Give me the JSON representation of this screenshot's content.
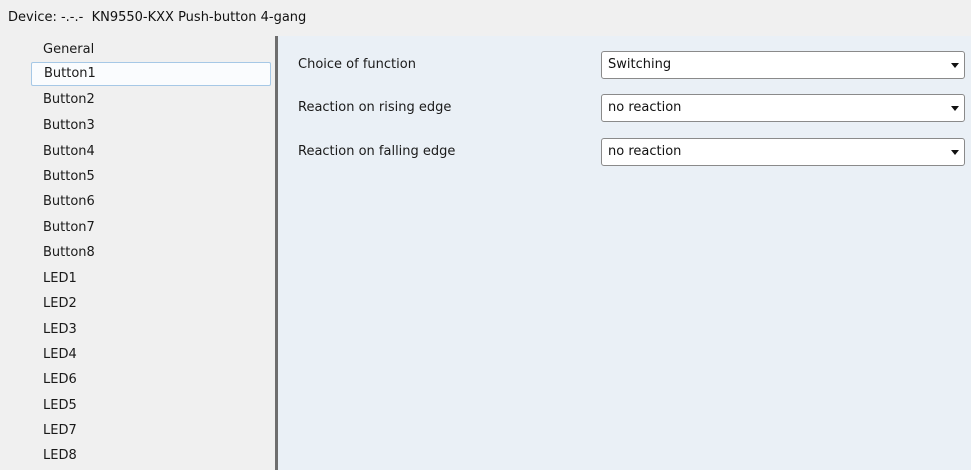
{
  "header": {
    "device_label": "Device: -.-.-  KN9550-KXX Push-button 4-gang"
  },
  "sidebar": {
    "selected_index": 1,
    "items": [
      {
        "label": "General"
      },
      {
        "label": "Button1"
      },
      {
        "label": "Button2"
      },
      {
        "label": "Button3"
      },
      {
        "label": "Button4"
      },
      {
        "label": "Button5"
      },
      {
        "label": "Button6"
      },
      {
        "label": "Button7"
      },
      {
        "label": "Button8"
      },
      {
        "label": "LED1"
      },
      {
        "label": "LED2"
      },
      {
        "label": "LED3"
      },
      {
        "label": "LED4"
      },
      {
        "label": "LED6"
      },
      {
        "label": "LED5"
      },
      {
        "label": "LED7"
      },
      {
        "label": "LED8"
      }
    ]
  },
  "params": [
    {
      "label": "Choice of function",
      "value": "Switching",
      "icon": "dropdown-arrow"
    },
    {
      "label": "Reaction on rising edge",
      "value": "no reaction",
      "icon": "dropdown-arrow"
    },
    {
      "label": "Reaction on falling edge",
      "value": "no reaction",
      "icon": "dropdown-arrow"
    }
  ],
  "colors": {
    "panel_background": "#eaf0f6",
    "sidebar_background": "#f0f0f0",
    "selection_border": "#a6c8e6",
    "splitter": "#6e6e6e"
  }
}
